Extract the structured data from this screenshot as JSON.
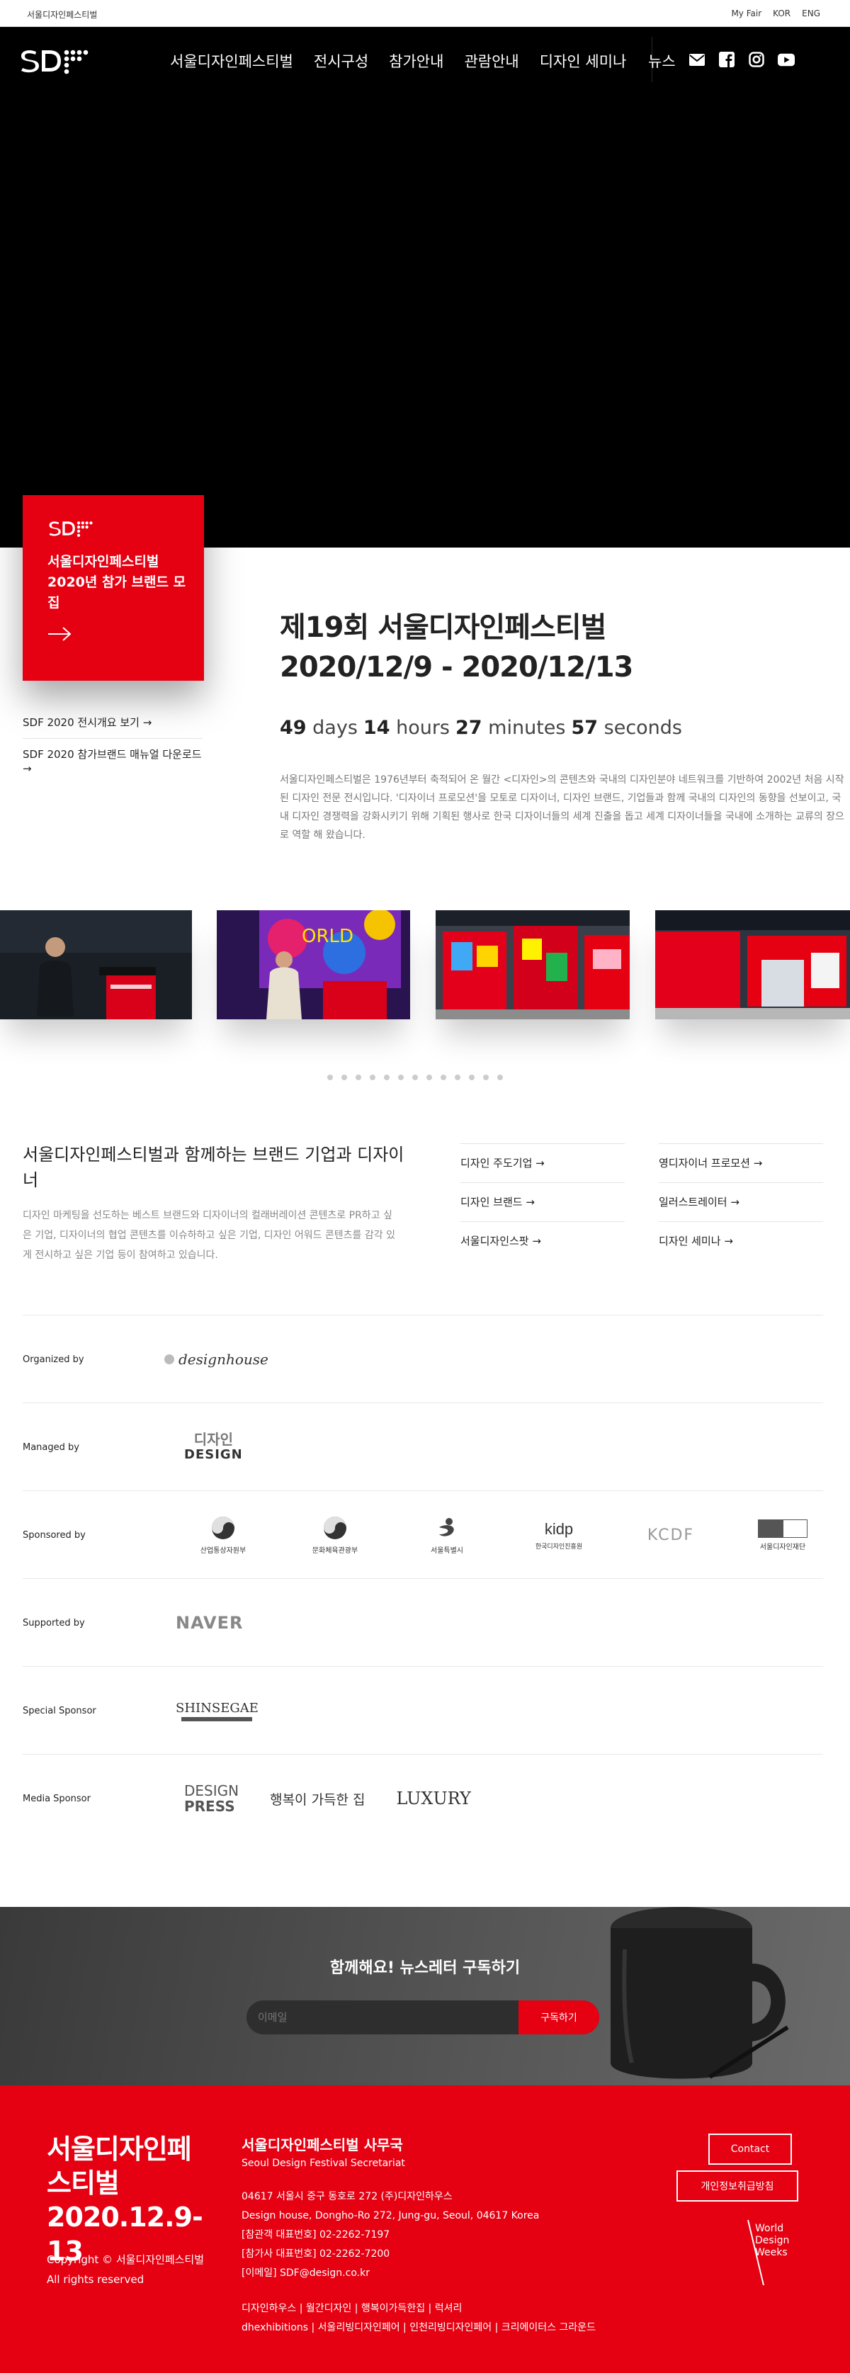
{
  "topbar": {
    "site_name": "서울디자인페스티벌",
    "links": [
      "My Fair",
      "KOR",
      "ENG"
    ]
  },
  "nav": {
    "items": [
      "서울디자인페스티벌",
      "전시구성",
      "참가안내",
      "관람안내",
      "디자인 세미나",
      "뉴스"
    ]
  },
  "social_icons": [
    "mail-icon",
    "facebook-icon",
    "instagram-icon",
    "youtube-icon"
  ],
  "recruit_card": {
    "title": "서울디자인페스티벌 2020년 참가 브랜드 모집"
  },
  "side_links": [
    "SDF 2020 전시개요 보기 →",
    "SDF 2020 참가브랜드 매뉴얼 다운로드 →"
  ],
  "event": {
    "title_line1": "제19회 서울디자인페스티벌",
    "title_line2": "2020/12/9 - 2020/12/13",
    "countdown": {
      "days": "49",
      "days_unit": "days",
      "hours": "14",
      "hours_unit": "hours",
      "minutes": "27",
      "minutes_unit": "minutes",
      "seconds": "57",
      "seconds_unit": "seconds"
    },
    "intro": "서울디자인페스티벌은 1976년부터 축적되어 온 월간 <디자인>의 콘텐츠와 국내의 디자인분야 네트워크를 기반하여 2002년 처음 시작된 디자인 전문 전시입니다. '디자이너 프로모션'을 모토로 디자이너, 디자인 브랜드, 기업들과 함께 국내의 디자인의 동향을 선보이고, 국내 디자인 경쟁력을 강화시키기 위해 기획된 행사로 한국 디자이너들의 세계 진출을 돕고 세계 디자이너들을 국내에 소개하는 교류의 장으로 역할 해 왔습니다."
  },
  "gallery": {
    "dot_count": 13
  },
  "brand_section": {
    "title": "서울디자인페스티벌과 함께하는 브랜드 기업과 디자이너",
    "description": "디자인 마케팅을 선도하는 베스트 브랜드와 디자이너의 컬래버레이션 콘텐츠로 PR하고 싶은 기업, 디자이너의 협업 콘텐츠를 이슈하하고 싶은 기업, 디자인 어워드 콘텐츠를 감각 있게 전시하고 싶은 기업 등이 참여하고 있습니다.",
    "links": [
      "디자인 주도기업 →",
      "영디자이너 프로모션 →",
      "디자인 브랜드 →",
      "일러스트레이터 →",
      "서울디자인스팟 →",
      "디자인 세미나 →"
    ]
  },
  "sponsors": {
    "organized_label": "Organized by",
    "organizer": "designhouse",
    "managed_label": "Managed by",
    "manager_line1": "디자인",
    "manager_line2": "DESIGN",
    "sponsored_label": "Sponsored by",
    "sponsored": [
      "산업통상자원부",
      "문화체육관광부",
      "서울특별시",
      "한국디자인진흥원",
      "KCDF",
      "서울디자인재단"
    ],
    "kidp": "kidp",
    "kcdf": "KCDF",
    "supported_label": "Supported by",
    "supporter": "NAVER",
    "special_label": "Special Sponsor",
    "special": "SHINSEGAE",
    "media_label": "Media Sponsor",
    "media_design": "DESIGN",
    "media_press": "PRESS",
    "media_happy": "행복이 가득한 집",
    "media_luxury": "LUXURY"
  },
  "newsletter": {
    "title": "함께해요! 뉴스레터 구독하기",
    "placeholder": "이메일",
    "button": "구독하기"
  },
  "footer": {
    "brand_line1": "서울디자인페",
    "brand_line2": "스티벌",
    "brand_line3": "2020.12.9-13",
    "copyright": "Copyright © 서울디자인페스티벌 All rights reserved",
    "office_title": "서울디자인페스티벌 사무국",
    "office_en": "Seoul Design Festival Secretariat",
    "address_lines": [
      "04617 서울시 중구 동호로 272 (주)디자인하우스",
      "Design house, Dongho-Ro 272, Jung-gu, Seoul, 04617 Korea",
      "[참관객 대표번호] 02-2262-7197",
      "[참가사 대표번호] 02-2262-7200",
      "[이메일] SDF@design.co.kr"
    ],
    "sites_line1": "디자인하우스 | 월간디자인 | 행복이가득한집 | 럭셔리",
    "sites_line2": "dhexhibitions | 서울리빙디자인페어 | 인천리빙디자인페어 | 크리에이터스 그라운드",
    "contact_button": "Contact",
    "privacy_button": "개인정보취급방침",
    "wdw_line1": "World",
    "wdw_line2": "Design",
    "wdw_line3": "Weeks"
  }
}
